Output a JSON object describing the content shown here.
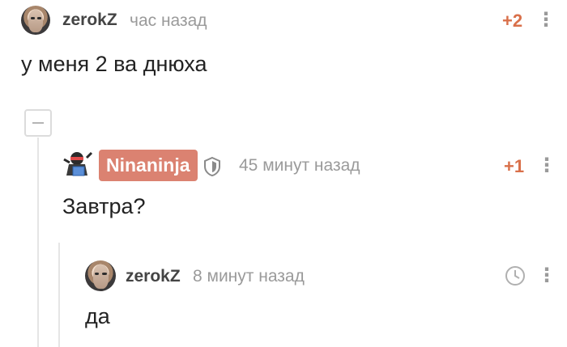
{
  "comments": [
    {
      "username": "zerokZ",
      "time": "час назад",
      "rating": "+2",
      "text": "у меня 2 ва днюха",
      "menu": "⋮"
    },
    {
      "username": "Ninaninja",
      "time": "45 минут назад",
      "rating": "+1",
      "text": "Завтра?",
      "menu": "⋮"
    },
    {
      "username": "zerokZ",
      "time": "8 минут назад",
      "text": "да",
      "menu": "⋮"
    }
  ],
  "icons": {
    "collapse": "minus-square-icon",
    "shield": "shield-icon",
    "clock": "clock-icon"
  },
  "colors": {
    "rating": "#d9704a",
    "badge": "#db8271",
    "muted": "#9a9a9a"
  }
}
